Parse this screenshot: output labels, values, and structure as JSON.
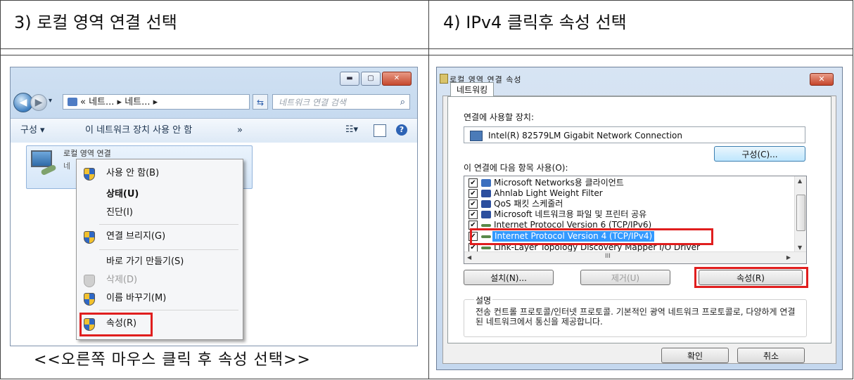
{
  "headers": {
    "left": "3) 로컬 영역 연결 선택",
    "right": "4) IPv4 클릭후 속성 선택"
  },
  "caption": "<<오른쪽 마우스 클릭 후 속성 선택>>",
  "explorer": {
    "address": "« 네트... ▸ 네트... ▸",
    "search_placeholder": "네트워크 연결 검색",
    "toolbar": {
      "organize": "구성 ▾",
      "disable_device": "이 네트워크 장치 사용 안 함",
      "more": "»"
    },
    "connection": {
      "name": "로컬 영역 연결",
      "sub": "네"
    },
    "context_menu": [
      {
        "label": "사용 안 함(B)",
        "icon": "shield-icon"
      },
      {
        "label": "상태(U)",
        "bold": true
      },
      {
        "label": "진단(I)"
      },
      {
        "label": "연결 브리지(G)",
        "icon": "shield-icon"
      },
      {
        "label": "바로 가기 만들기(S)"
      },
      {
        "label": "삭제(D)",
        "icon": "shield-icon",
        "disabled": true
      },
      {
        "label": "이름 바꾸기(M)",
        "icon": "shield-icon"
      },
      {
        "label": "속성(R)",
        "icon": "shield-icon"
      }
    ]
  },
  "dialog": {
    "title": "로컬 영역 연결 속성",
    "tab": "네트워킹",
    "device_label": "연결에 사용할 장치:",
    "device": "Intel(R) 82579LM Gigabit Network Connection",
    "configure": "구성(C)...",
    "items_label": "이 연결에 다음 항목 사용(O):",
    "items": [
      {
        "label": "Microsoft Networks용 클라이언트",
        "checked": true,
        "icon_color": "#3b6fbf"
      },
      {
        "label": "Ahnlab Light Weight Filter",
        "checked": true,
        "icon_color": "#2c4f9e"
      },
      {
        "label": "QoS 패킷 스케줄러",
        "checked": true,
        "icon_color": "#2c4f9e"
      },
      {
        "label": "Microsoft 네트워크용 파일 및 프린터 공유",
        "checked": true,
        "icon_color": "#2c4f9e"
      },
      {
        "label": "Internet Protocol Version 6 (TCP/IPv6)",
        "checked": true,
        "icon_color": "#5a8a4a"
      },
      {
        "label": "Internet Protocol Version 4 (TCP/IPv4)",
        "checked": true,
        "selected": true,
        "icon_color": "#5a8a4a"
      },
      {
        "label": "Link-Layer Topology Discovery Mapper I/O Driver",
        "checked": true,
        "icon_color": "#5a8a4a"
      }
    ],
    "scroll_mid": "III",
    "install": "설치(N)...",
    "uninstall": "제거(U)",
    "properties": "속성(R)",
    "description_title": "설명",
    "description": "전송 컨트롤 프로토콜/인터넷 프로토콜. 기본적인 광역 네트워크 프로토콜로, 다양하게 연결된 네트워크에서 통신을 제공합니다.",
    "ok": "확인",
    "cancel": "취소"
  },
  "colors": {
    "highlight_box": "#e01e1e",
    "selection": "#3399ff"
  }
}
